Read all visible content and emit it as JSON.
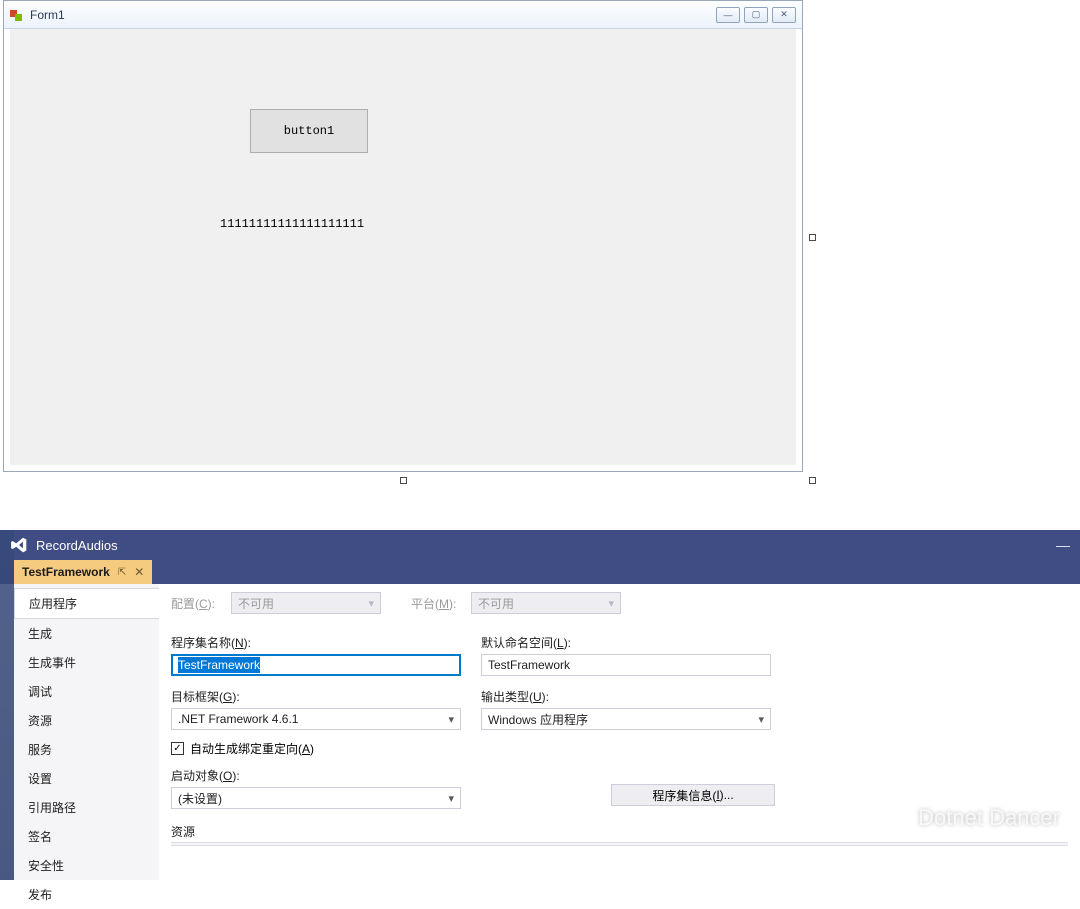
{
  "designer": {
    "form_title": "Form1",
    "button_label": "button1",
    "label_text": "11111111111111111111",
    "win_buttons": {
      "min": "—",
      "max": "▢",
      "close": "✕"
    }
  },
  "vs": {
    "solution_title": "RecordAudios",
    "tab_title": "TestFramework",
    "tab_pin": "⇱",
    "tab_close": "✕",
    "win_min": "—",
    "side_nav": [
      "应用程序",
      "生成",
      "生成事件",
      "调试",
      "资源",
      "服务",
      "设置",
      "引用路径",
      "签名",
      "安全性",
      "发布"
    ],
    "config_label": "配置(",
    "config_hot": "C",
    "config_suffix": "):",
    "config_value": "不可用",
    "platform_label": "平台(",
    "platform_hot": "M",
    "platform_suffix": "):",
    "platform_value": "不可用",
    "assembly_name_label": "程序集名称(",
    "assembly_name_hot": "N",
    "assembly_name_suffix": "):",
    "assembly_name_value": "TestFramework",
    "default_ns_label": "默认命名空间(",
    "default_ns_hot": "L",
    "default_ns_suffix": "):",
    "default_ns_value": "TestFramework",
    "target_fw_label": "目标框架(",
    "target_fw_hot": "G",
    "target_fw_suffix": "):",
    "target_fw_value": ".NET Framework 4.6.1",
    "output_type_label": "输出类型(",
    "output_type_hot": "U",
    "output_type_suffix": "):",
    "output_type_value": "Windows 应用程序",
    "auto_redirect_label": "自动生成绑定重定向(",
    "auto_redirect_hot": "A",
    "auto_redirect_suffix": ")",
    "auto_redirect_check": "✓",
    "startup_label": "启动对象(",
    "startup_hot": "O",
    "startup_suffix": "):",
    "startup_value": "(未设置)",
    "asm_info_btn": "程序集信息(",
    "asm_info_hot": "I",
    "asm_info_suffix": ")...",
    "resources_label": "资源"
  },
  "watermark": {
    "text": "Dotnet Dancer"
  }
}
